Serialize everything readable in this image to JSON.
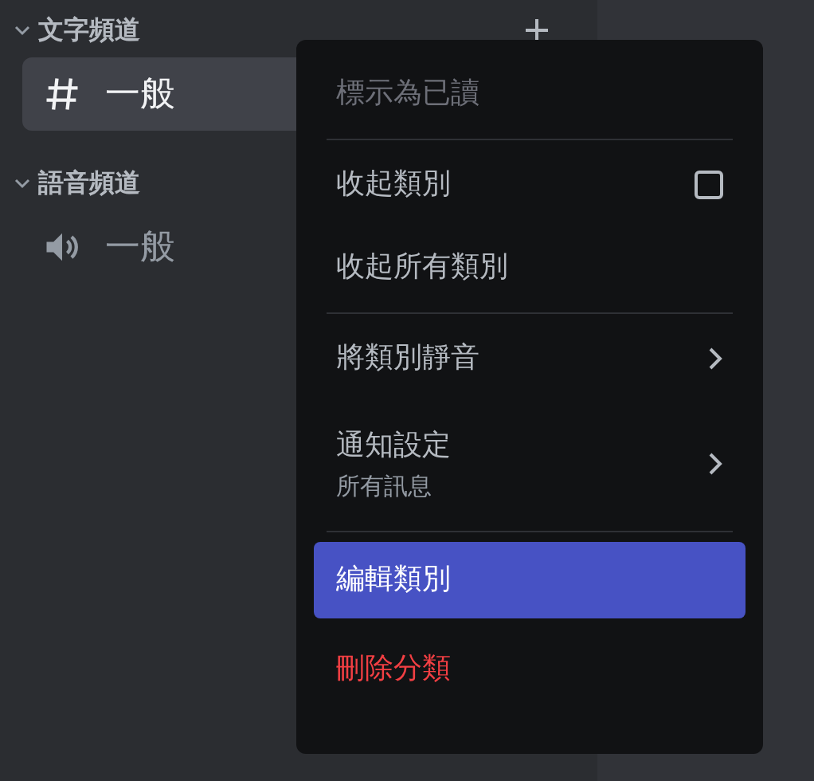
{
  "categories": [
    {
      "name": "文字頻道",
      "expanded": true,
      "channels": [
        {
          "name": "一般",
          "kind": "text",
          "selected": true
        }
      ]
    },
    {
      "name": "語音頻道",
      "expanded": true,
      "channels": [
        {
          "name": "一般",
          "kind": "voice",
          "selected": false
        }
      ]
    }
  ],
  "context_menu": {
    "groups": [
      [
        {
          "label": "標示為已讀",
          "kind": "item",
          "disabled": true,
          "selected": false
        }
      ],
      [
        {
          "label": "收起類別",
          "kind": "checkbox",
          "checked": false,
          "disabled": false,
          "selected": false
        },
        {
          "label": "收起所有類別",
          "kind": "item",
          "disabled": false,
          "selected": false
        }
      ],
      [
        {
          "label": "將類別靜音",
          "kind": "submenu",
          "disabled": false,
          "selected": false
        },
        {
          "label": "通知設定",
          "sublabel": "所有訊息",
          "kind": "submenu",
          "disabled": false,
          "selected": false
        }
      ],
      [
        {
          "label": "編輯類別",
          "kind": "item",
          "disabled": false,
          "selected": true
        },
        {
          "label": "刪除分類",
          "kind": "danger",
          "disabled": false,
          "selected": false
        }
      ]
    ]
  }
}
